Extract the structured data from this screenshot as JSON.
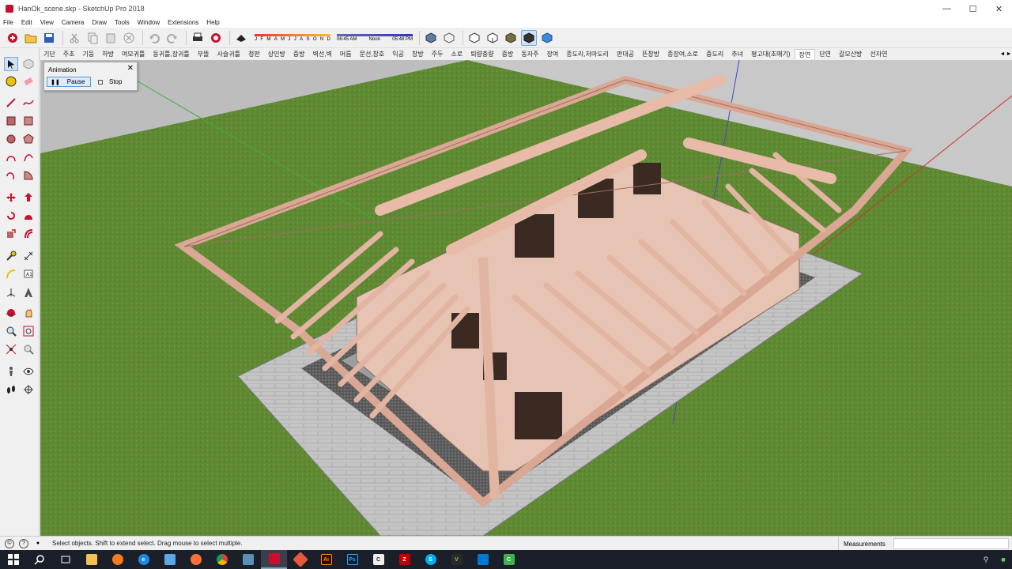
{
  "window": {
    "title": "HanOk_scene.skp - SketchUp Pro 2018",
    "minimize": "—",
    "maximize": "☐",
    "close": "✕"
  },
  "menu": [
    "File",
    "Edit",
    "View",
    "Camera",
    "Draw",
    "Tools",
    "Window",
    "Extensions",
    "Help"
  ],
  "shadows": {
    "months": [
      "J",
      "F",
      "M",
      "A",
      "M",
      "J",
      "J",
      "A",
      "S",
      "O",
      "N",
      "D"
    ],
    "time_start": "06:45 AM",
    "time_mid": "Noon",
    "time_end": "05:48 PM"
  },
  "scenes": {
    "tabs": [
      "기단",
      "주초",
      "기둥",
      "하방",
      "여모귀틀",
      "동귀틀,장귀틀",
      "부뜰",
      "사슬귀틀",
      "청판",
      "상인방",
      "중방",
      "벽선,벽",
      "머름",
      "문선,창호",
      "익공",
      "창방",
      "주두",
      "소로",
      "퇴량충량",
      "중방",
      "동자주",
      "장여",
      "종도리,처마도리",
      "판대공",
      "뜬창방",
      "종장여,소로",
      "중도리",
      "추녀",
      "평고대(초매기)",
      "장연",
      "단연",
      "갈모산방",
      "선자연"
    ],
    "active_index": 29,
    "prev": "◄",
    "next": "►"
  },
  "animation": {
    "title": "Animation",
    "close": "✕",
    "pause_label": "Pause",
    "stop_label": "Stop"
  },
  "status": {
    "hint": "Select objects. Shift to extend select. Drag mouse to select multiple.",
    "info_icon": "?",
    "geo_icon": "©",
    "user_icon": "●",
    "measurements_label": "Measurements"
  },
  "taskbar": {
    "apps": [
      "Start",
      "Search",
      "Task View",
      "File Explorer",
      "Avast",
      "Edge",
      "Store",
      "Firefox",
      "Chrome",
      "Capture",
      "SketchUp",
      "Autodesk",
      "Illustrator",
      "Photoshop",
      "Cinema4D",
      "FileZilla",
      "Skype",
      "Corel",
      "Outlook",
      "Camtasia"
    ]
  },
  "colors": {
    "grass": "#5f8a33",
    "timber": "#e2b4a2",
    "stone": "#bdbdbd"
  }
}
